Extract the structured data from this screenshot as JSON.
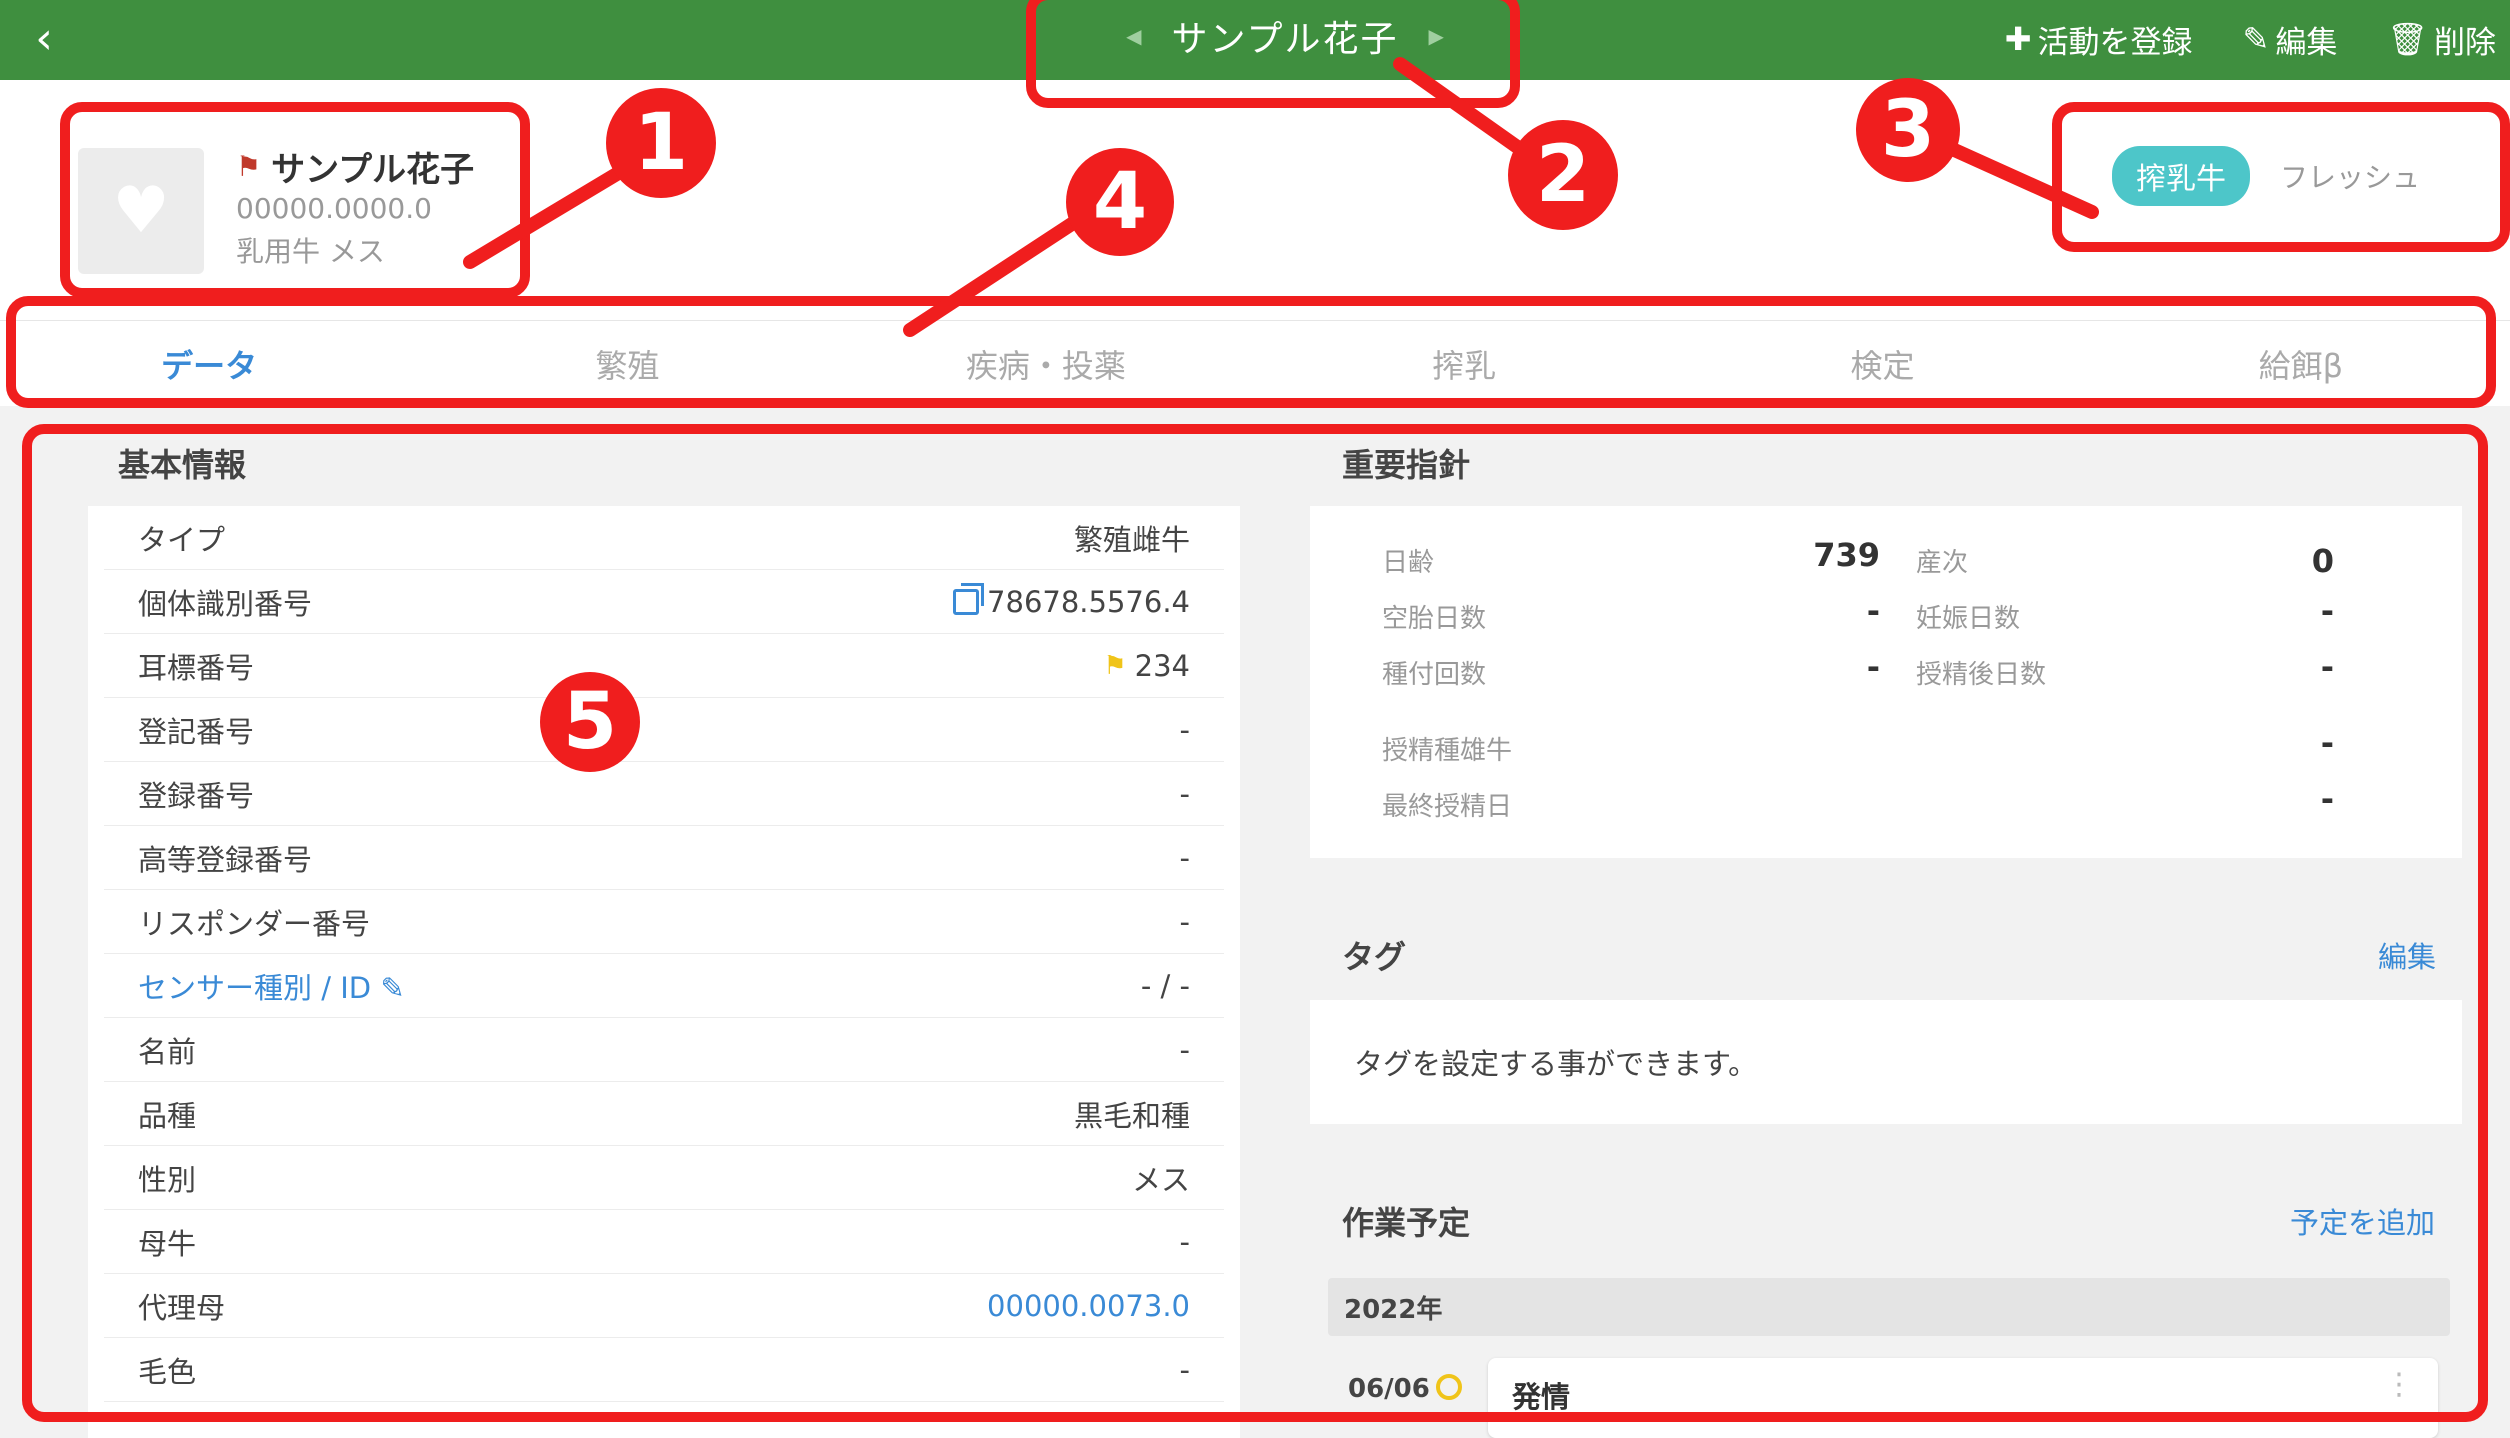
{
  "topbar": {
    "title": "サンプル花子",
    "actions": [
      {
        "label": "活動を登録"
      },
      {
        "label": "編集"
      },
      {
        "label": "削除"
      }
    ]
  },
  "animal": {
    "name": "サンプル花子",
    "id": "00000.0000.0",
    "sub": "乳用牛 メス",
    "status_badge": "搾乳牛",
    "status_sub": "フレッシュ"
  },
  "tabs": [
    "データ",
    "繁殖",
    "疾病・投薬",
    "搾乳",
    "検定",
    "給餌β"
  ],
  "basic_info": {
    "title": "基本情報",
    "rows": [
      {
        "label": "タイプ",
        "value": "繁殖雌牛"
      },
      {
        "label": "個体識別番号",
        "value": "78678.5576.4"
      },
      {
        "label": "耳標番号",
        "value": "234"
      },
      {
        "label": "登記番号",
        "value": "-"
      },
      {
        "label": "登録番号",
        "value": "-"
      },
      {
        "label": "高等登録番号",
        "value": "-"
      },
      {
        "label": "リスポンダー番号",
        "value": "-"
      },
      {
        "label": "センサー種別 / ID",
        "value": "- / -"
      },
      {
        "label": "名前",
        "value": "-"
      },
      {
        "label": "品種",
        "value": "黒毛和種"
      },
      {
        "label": "性別",
        "value": "メス"
      },
      {
        "label": "母牛",
        "value": "-"
      },
      {
        "label": "代理母",
        "value": "00000.0073.0"
      },
      {
        "label": "毛色",
        "value": "-"
      }
    ]
  },
  "indicators": {
    "title": "重要指針",
    "items": [
      {
        "label": "日齢",
        "value": "739"
      },
      {
        "label": "産次",
        "value": "0"
      },
      {
        "label": "空胎日数",
        "value": "-"
      },
      {
        "label": "妊娠日数",
        "value": "-"
      },
      {
        "label": "種付回数",
        "value": "-"
      },
      {
        "label": "授精後日数",
        "value": "-"
      },
      {
        "label": "授精種雄牛",
        "value": "-"
      },
      {
        "label": "最終授精日",
        "value": "-"
      }
    ]
  },
  "tags": {
    "title": "タグ",
    "edit_label": "編集",
    "empty_text": "タグを設定する事ができます。"
  },
  "schedule": {
    "title": "作業予定",
    "add_label": "予定を追加",
    "year": "2022年",
    "items": [
      {
        "date": "06/06",
        "title": "発情"
      }
    ]
  },
  "annotations": [
    "1",
    "2",
    "3",
    "4",
    "5"
  ],
  "colors": {
    "header_green": "#3f8f3f",
    "accent_blue": "#3a8ad6",
    "badge_teal": "#4dc6c9",
    "annotation_red": "#f01e1e"
  }
}
